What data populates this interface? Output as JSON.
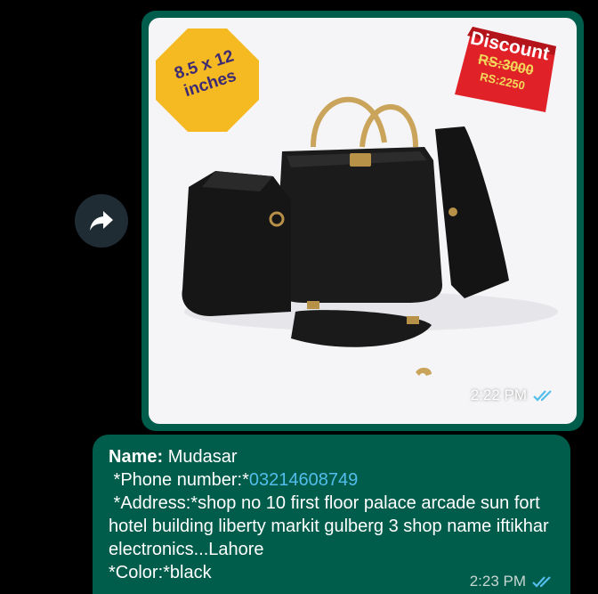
{
  "image_message": {
    "size_badge": [
      "8.5 x 12",
      "inches"
    ],
    "discount_badge": {
      "title": "Discount",
      "old_price": "RS:3000",
      "new_price": "RS:2250"
    },
    "time": "2:22 PM",
    "status_icon": "double-check-icon",
    "colors": {
      "bubble": "#005c4b",
      "tick": "#53bdeb"
    }
  },
  "forward_button": {
    "icon": "forward-arrow-icon"
  },
  "text_message": {
    "name_label": "Name:",
    "name_value": " Mudasar",
    "phone_label": " *Phone number:*",
    "phone_value": "03214608749",
    "address_label": " *Address:*",
    "address_value": "shop no 10 first floor palace arcade sun fort hotel building liberty markit gulberg 3 shop name iftikhar electronics...Lahore",
    "color_label": "*Color:*",
    "color_value": "black",
    "time": "2:23 PM",
    "status_icon": "double-check-icon"
  }
}
